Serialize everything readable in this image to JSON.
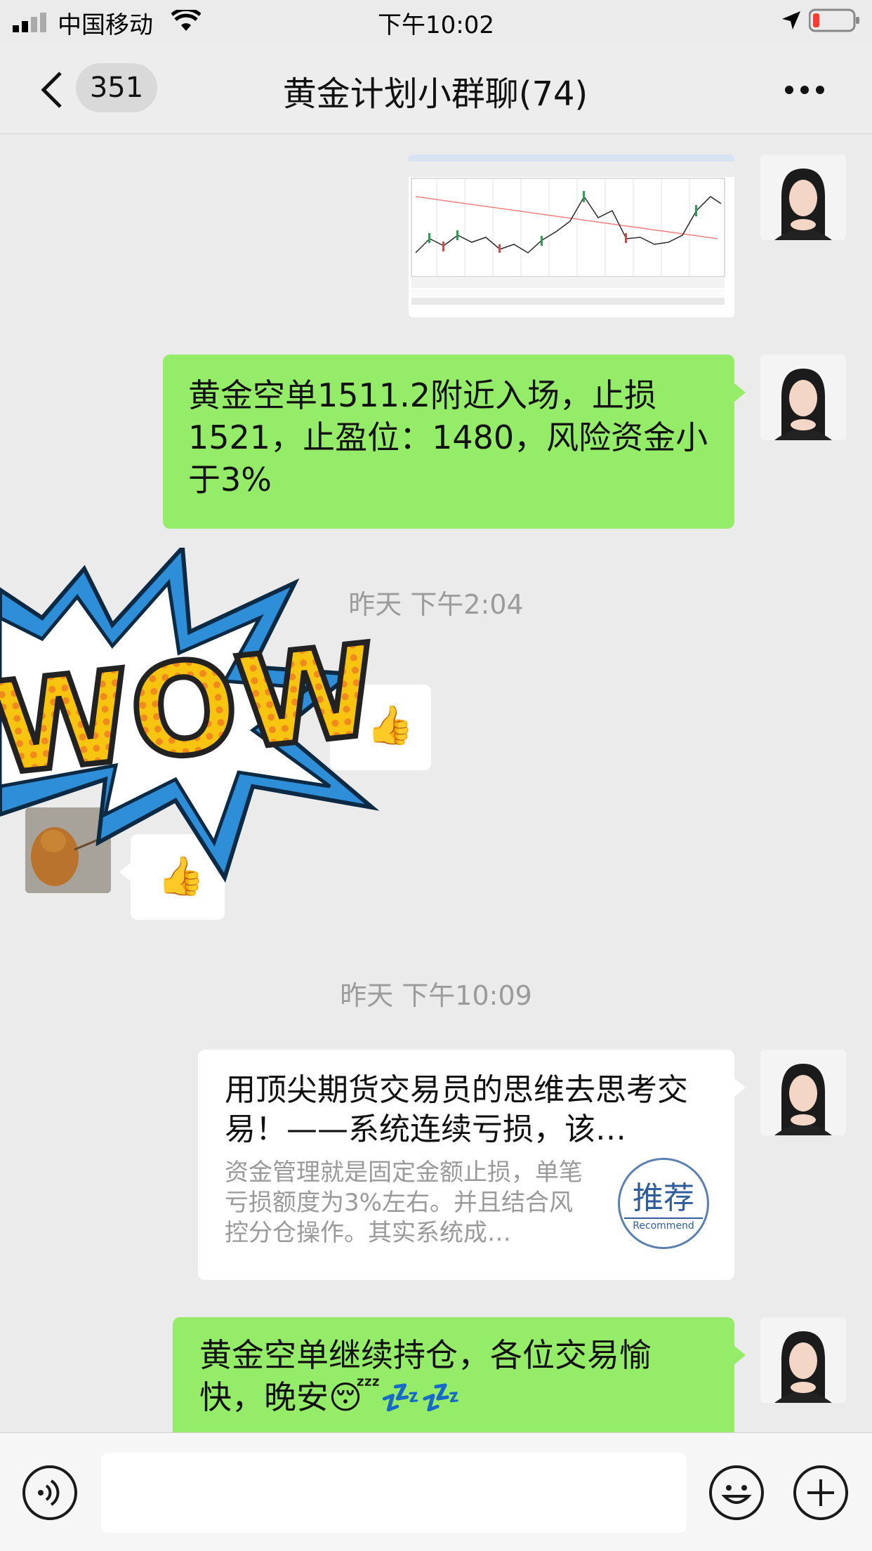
{
  "status_bar": {
    "carrier": "中国移动",
    "time": "下午10:02"
  },
  "nav": {
    "unread_count": "351",
    "title": "黄金计划小群聊(74)"
  },
  "messages": {
    "m2_text": "黄金空单1511.2附近入场，止损1521，止盈位：1480，风险资金小于3%",
    "ts1": "昨天 下午2:04",
    "ts2": "昨天 下午10:09",
    "thumbs": "👍",
    "wow_sticker": "WOW!",
    "article_title": "用顶尖期货交易员的思维去思考交易！——系统连续亏损，该…",
    "article_desc": "资金管理就是固定金额止损，单笔亏损额度为3%左右。并且结合风控分仓操作。其实系统成…",
    "article_badge_cn": "推荐",
    "article_badge_en": "Recommend",
    "m_last_text": "黄金空单继续持仓，各位交易愉快，晚安😴💤💤"
  },
  "colors": {
    "self_bubble": "#95ec69",
    "other_bubble": "#ffffff",
    "background": "#ebebeb"
  }
}
